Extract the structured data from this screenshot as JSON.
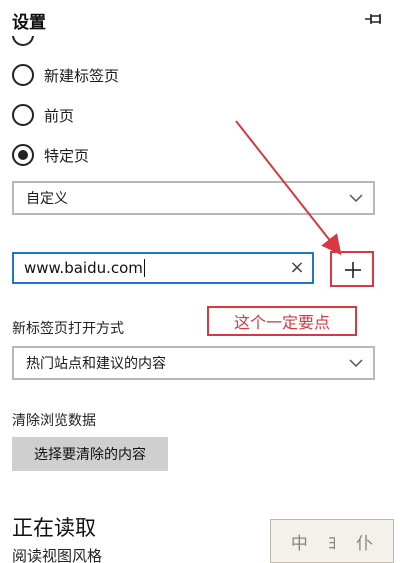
{
  "header": {
    "title": "设置",
    "pin_icon": "pin-icon"
  },
  "startup_options": [
    {
      "label": "新建标签页",
      "checked": false
    },
    {
      "label": "前页",
      "checked": false
    },
    {
      "label": "特定页",
      "checked": true
    }
  ],
  "specific_page": {
    "select_value": "自定义",
    "url_value": "www.baidu.com",
    "clear_icon": "close-icon",
    "add_icon": "plus-icon"
  },
  "annotation": {
    "callout_text": "这个一定要点",
    "color": "#d6393f"
  },
  "new_tab": {
    "label": "新标签页打开方式",
    "select_value": "热门站点和建议的内容"
  },
  "clear_data": {
    "label": "清除浏览数据",
    "button_label": "选择要清除的内容"
  },
  "reading": {
    "heading": "正在读取",
    "subheading": "阅读视图风格"
  },
  "watermark": {
    "chars": [
      "中",
      "ﾖ",
      "仆"
    ]
  },
  "colors": {
    "focus_blue": "#1e78c8",
    "annotation_red": "#d6393f",
    "button_gray": "#cfcfcf"
  }
}
